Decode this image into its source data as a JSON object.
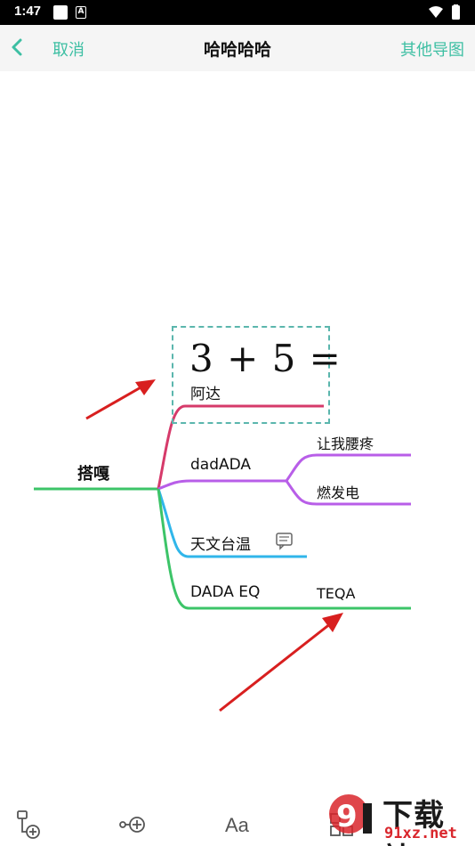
{
  "status_bar": {
    "time": "1:47",
    "notif_a": "A"
  },
  "nav": {
    "cancel": "取消",
    "title": "哈哈哈哈",
    "other_maps": "其他导图"
  },
  "mindmap": {
    "root": "搭嘎",
    "formula": "3 + 5 =",
    "branches": [
      {
        "label": "阿达",
        "color": "#d63a6a"
      },
      {
        "label": "dadADA",
        "color": "#b85ee8",
        "children": [
          "让我腰疼",
          "燃发电"
        ]
      },
      {
        "label": "天文台温",
        "color": "#30b6ea"
      },
      {
        "label": "DADA EQ",
        "color": "#3cc468",
        "children": [
          "TEQA"
        ]
      }
    ],
    "root_color": "#3cc468",
    "selection_color": "#5bb6ad"
  },
  "toolbar": {
    "font_label": "Aa"
  },
  "watermark": {
    "brand": "下载站",
    "url": "91xz.net"
  },
  "accent_color": "#3dbfa3"
}
